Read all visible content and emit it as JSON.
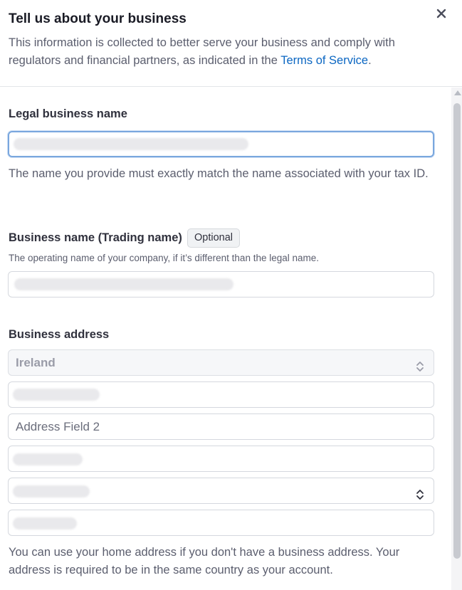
{
  "header": {
    "title": "Tell us about your business",
    "subtitle_prefix": "This information is collected to better serve your business and comply with regulators and financial partners, as indicated in the ",
    "terms_link": "Terms of Service",
    "subtitle_suffix": "."
  },
  "legal_name": {
    "label": "Legal business name",
    "value": "",
    "helper": "The name you provide must exactly match the name associated with your tax ID."
  },
  "trading_name": {
    "label": "Business name (Trading name)",
    "badge": "Optional",
    "helper": "The operating name of your company, if it’s different than the legal name.",
    "value": ""
  },
  "address": {
    "label": "Business address",
    "country": "Ireland",
    "line1": "",
    "line2_placeholder": "Address Field 2",
    "city": "",
    "county": "",
    "postal": "",
    "helper": "You can use your home address if you don't have a business address. Your address is required to be in the same country as your account."
  },
  "icons": {
    "close": "close-icon",
    "select": "chevron-up-down-icon"
  }
}
